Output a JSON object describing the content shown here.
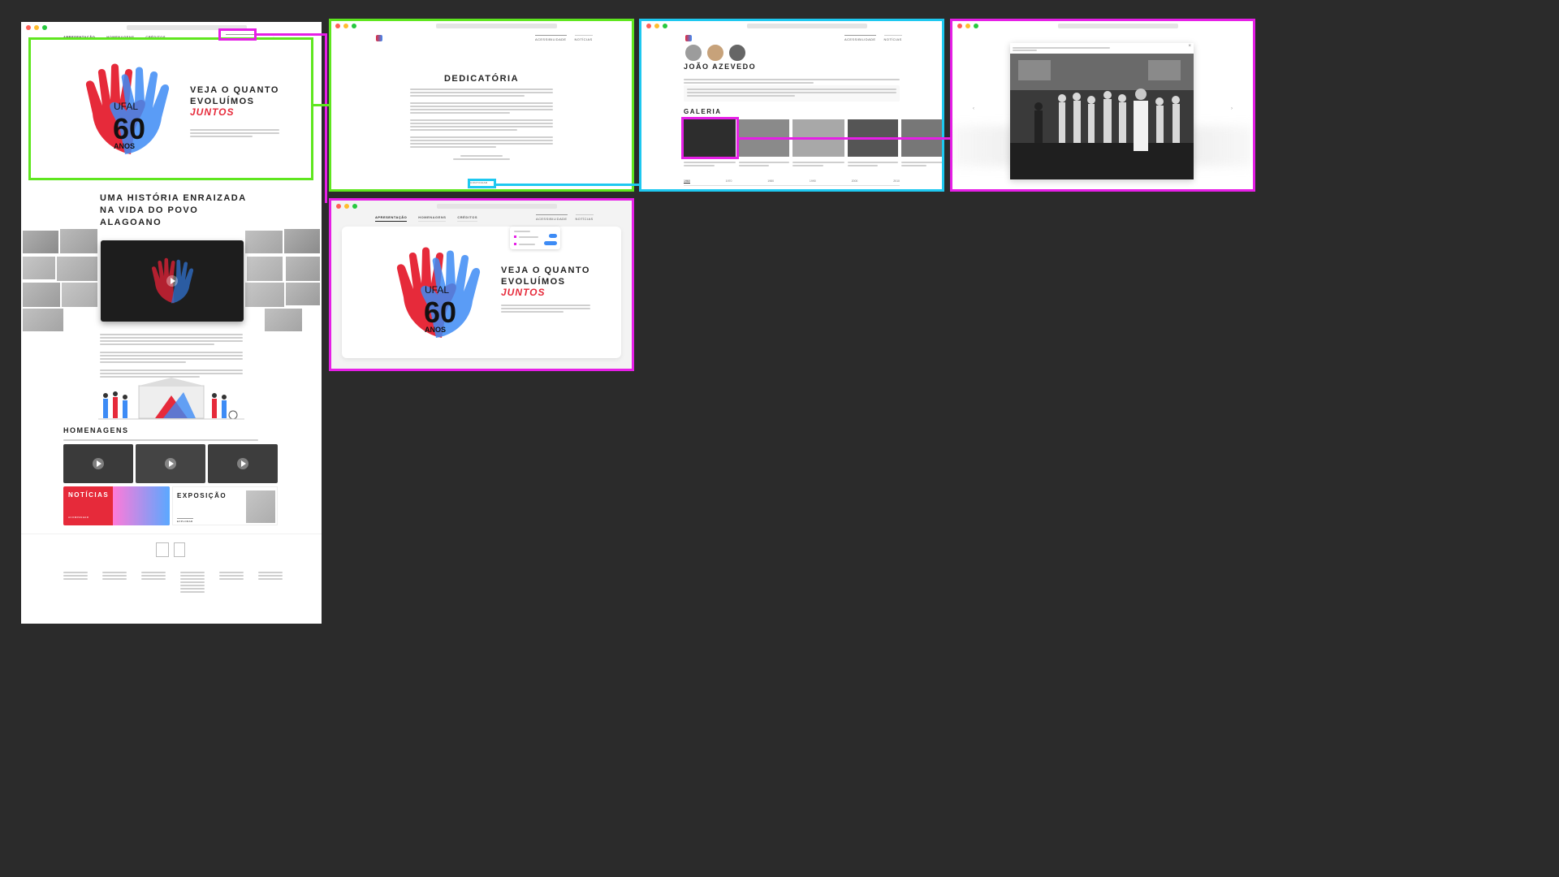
{
  "nav": {
    "tabs": [
      "APRESENTAÇÃO",
      "HOMENAGENS",
      "CRÉDITOS"
    ],
    "accessibility": "ACESSIBILIDADE",
    "news": "NOTÍCIAS"
  },
  "hero": {
    "logo_main": "UFAL",
    "logo_number": "60",
    "logo_sub": "ANOS",
    "headline_line1": "VEJA O QUANTO",
    "headline_line2": "EVOLUÍMOS",
    "headline_script": "JUNTOS"
  },
  "history": {
    "title_line1": "UMA HISTÓRIA ENRAIZADA",
    "title_line2": "NA VIDA DO POVO",
    "title_line3": "ALAGOANO"
  },
  "homenagens": {
    "title": "HOMENAGENS"
  },
  "cards": {
    "news_title": "NOTÍCIAS",
    "news_button": "ACOMPANHAR",
    "expo_title": "EXPOSIÇÃO",
    "expo_button": "EXPLORAR"
  },
  "dedicatoria": {
    "title": "DEDICATÓRIA",
    "button": "CONTINUAR"
  },
  "profile": {
    "name": "JOÃO AZEVEDO",
    "gallery_title": "GALERIA",
    "timeline": [
      "1960",
      "1970",
      "1980",
      "1990",
      "2000",
      "2010"
    ]
  },
  "colors": {
    "green": "#5fe61f",
    "cyan": "#1ec8f0",
    "magenta": "#e61fe6",
    "red": "#e62a3a",
    "blue": "#3d8bf5"
  }
}
